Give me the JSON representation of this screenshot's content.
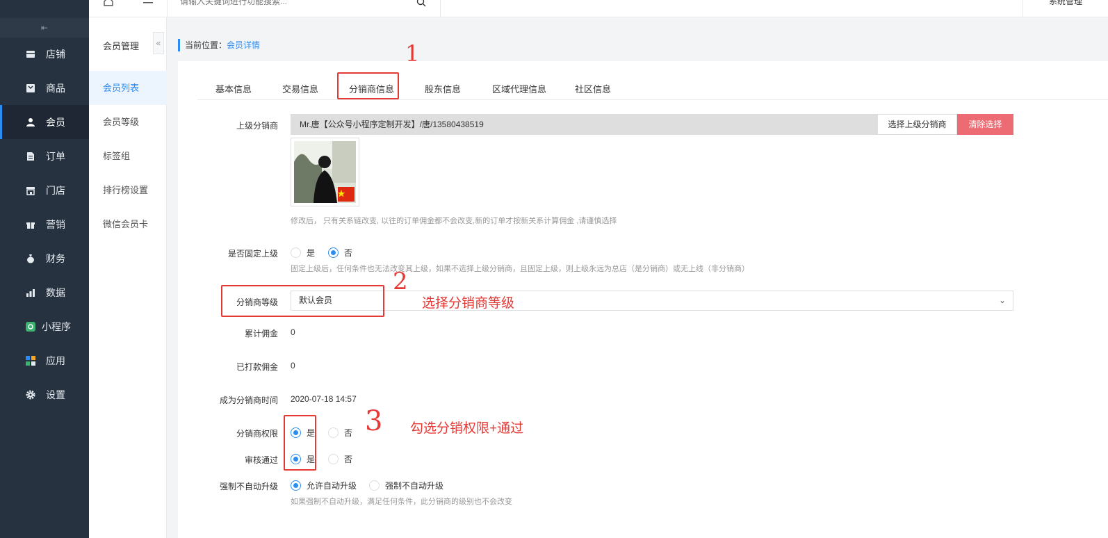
{
  "sidebar": {
    "collapse_label": "⇤",
    "items": [
      {
        "label": "店铺",
        "icon": "store-icon"
      },
      {
        "label": "商品",
        "icon": "goods-icon"
      },
      {
        "label": "会员",
        "icon": "user-icon"
      },
      {
        "label": "订单",
        "icon": "order-icon"
      },
      {
        "label": "门店",
        "icon": "shop-icon"
      },
      {
        "label": "营销",
        "icon": "gift-icon"
      },
      {
        "label": "财务",
        "icon": "money-bag-icon"
      },
      {
        "label": "数据",
        "icon": "chart-icon"
      },
      {
        "label": "小程序",
        "icon": "mini-program-icon"
      },
      {
        "label": "应用",
        "icon": "apps-icon"
      },
      {
        "label": "设置",
        "icon": "gear-icon"
      }
    ]
  },
  "submenu": {
    "title": "会员管理",
    "toggle": "«",
    "items": [
      {
        "label": "会员列表"
      },
      {
        "label": "会员等级"
      },
      {
        "label": "标签组"
      },
      {
        "label": "排行榜设置"
      },
      {
        "label": "微信会员卡"
      }
    ]
  },
  "topbar": {
    "search_placeholder": "请输入关键词进行功能搜索...",
    "system_label": "系统管理"
  },
  "breadcrumb": {
    "prefix": "当前位置：",
    "current": "会员详情"
  },
  "tabs": [
    {
      "label": "基本信息"
    },
    {
      "label": "交易信息"
    },
    {
      "label": "分销商信息"
    },
    {
      "label": "股东信息"
    },
    {
      "label": "区域代理信息"
    },
    {
      "label": "社区信息"
    }
  ],
  "form": {
    "parent": {
      "label": "上级分销商",
      "value": "Mr.唐【公众号小程序定制开发】/唐/13580438519",
      "choose_btn": "选择上级分销商",
      "clear_btn": "清除选择",
      "hint": "修改后， 只有关系链改变, 以往的订单佣金都不会改变,新的订单才按新关系计算佣金 ,请谨慎选择"
    },
    "fixed_parent": {
      "label": "是否固定上级",
      "options": [
        "是",
        "否"
      ],
      "selected": "否",
      "hint": "固定上级后，任何条件也无法改变其上级，如果不选择上级分销商，且固定上级，则上级永远为总店（是分销商）或无上线（非分销商）"
    },
    "level": {
      "label": "分销商等级",
      "value": "默认会员",
      "arrow": "⌄"
    },
    "total_commission": {
      "label": "累计佣金",
      "value": "0"
    },
    "paid_commission": {
      "label": "已打款佣金",
      "value": "0"
    },
    "become_time": {
      "label": "成为分销商时间",
      "value": "2020-07-18 14:57"
    },
    "permission": {
      "label": "分销商权限",
      "options": [
        "是",
        "否"
      ],
      "selected": "是"
    },
    "audit": {
      "label": "审核通过",
      "options": [
        "是",
        "否"
      ],
      "selected": "是"
    },
    "force_no_upgrade": {
      "label": "强制不自动升级",
      "options": [
        "允许自动升级",
        "强制不自动升级"
      ],
      "selected": "允许自动升级",
      "hint": "如果强制不自动升级，满足任何条件，此分销商的级别也不会改变"
    }
  },
  "annotations": {
    "mark1": "1",
    "mark2": "2",
    "mark3": "3",
    "text2": "选择分销商等级",
    "text3": "勾选分销权限+通过"
  },
  "colors": {
    "accent": "#2d8cf0",
    "danger": "#ed6b73",
    "sidebar_bg": "#273240",
    "annotation": "#e53935"
  }
}
